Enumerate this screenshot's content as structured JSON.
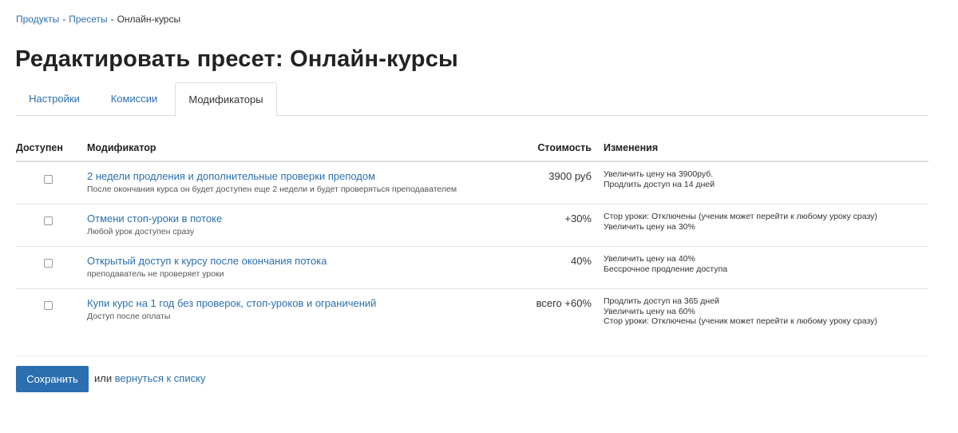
{
  "breadcrumb": {
    "items": [
      "Продукты",
      "Пресеты"
    ],
    "separator": "-",
    "current": "Онлайн-курсы"
  },
  "page_title": "Редактировать пресет: Онлайн-курсы",
  "tabs": [
    {
      "label": "Настройки",
      "active": false
    },
    {
      "label": "Комиссии",
      "active": false
    },
    {
      "label": "Модификаторы",
      "active": true
    }
  ],
  "table": {
    "headers": {
      "available": "Доступен",
      "modifier": "Модификатор",
      "cost": "Стоимость",
      "changes": "Изменения"
    },
    "rows": [
      {
        "checked": false,
        "title": "2 недели продления и дополнительные проверки преподом",
        "description": "После окончания курса он будет доступен еще 2 недели и будет проверяться преподавателем",
        "cost": "3900 руб",
        "changes": [
          "Увеличить цену на 3900руб.",
          "Продлить доступ на 14 дней"
        ]
      },
      {
        "checked": false,
        "title": "Отмени стоп-уроки в потоке",
        "description": "Любой урок доступен сразу",
        "cost": "+30%",
        "changes": [
          "Стор уроки: Отключены (ученик может перейти к любому уроку сразу)",
          "Увеличить цену на 30%"
        ]
      },
      {
        "checked": false,
        "title": "Открытый доступ к курсу после окончания потока",
        "description": "преподаватель не проверяет уроки",
        "cost": "40%",
        "changes": [
          "Увеличить цену на 40%",
          "Бессрочное продление доступа"
        ]
      },
      {
        "checked": false,
        "title": "Купи курс на 1 год без проверок, стоп-уроков и ограничений",
        "description": "Доступ после оплаты",
        "cost": "всего +60%",
        "changes": [
          "Продлить доступ на 365 дней",
          "Увеличить цену на 60%",
          "Стор уроки: Отключены (ученик может перейти к любому уроку сразу)"
        ]
      }
    ]
  },
  "footer": {
    "save_label": "Сохранить",
    "or_text": "или",
    "back_link": "вернуться к списку"
  },
  "colors": {
    "link": "#2a6fb0",
    "button_bg": "#2a6fb0",
    "border": "#dddddd"
  }
}
